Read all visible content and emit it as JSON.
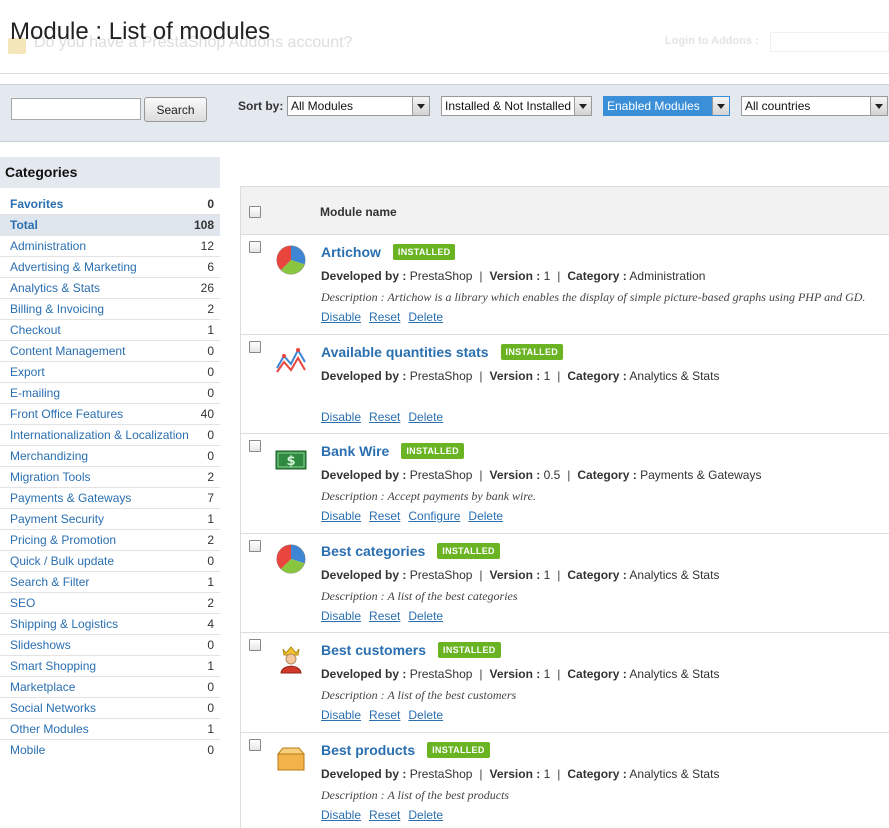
{
  "header": {
    "title": "Module : List of modules",
    "ghost_text": "Do you have a PrestaShop Addons account?",
    "ghost_login": "Login to Addons :"
  },
  "toolbar": {
    "search_value": "",
    "search_button": "Search",
    "sort_label": "Sort by:",
    "filter_all_modules": "All Modules",
    "filter_install": "Installed & Not Installed",
    "filter_enabled": "Enabled Modules",
    "filter_country": "All countries"
  },
  "sidebar": {
    "title": "Categories",
    "items": [
      {
        "label": "Favorites",
        "count": "0"
      },
      {
        "label": "Total",
        "count": "108"
      },
      {
        "label": "Administration",
        "count": "12"
      },
      {
        "label": "Advertising & Marketing",
        "count": "6"
      },
      {
        "label": "Analytics & Stats",
        "count": "26"
      },
      {
        "label": "Billing & Invoicing",
        "count": "2"
      },
      {
        "label": "Checkout",
        "count": "1"
      },
      {
        "label": "Content Management",
        "count": "0"
      },
      {
        "label": "Export",
        "count": "0"
      },
      {
        "label": "E-mailing",
        "count": "0"
      },
      {
        "label": "Front Office Features",
        "count": "40"
      },
      {
        "label": "Internationalization & Localization",
        "count": "0"
      },
      {
        "label": "Merchandizing",
        "count": "0"
      },
      {
        "label": "Migration Tools",
        "count": "2"
      },
      {
        "label": "Payments & Gateways",
        "count": "7"
      },
      {
        "label": "Payment Security",
        "count": "1"
      },
      {
        "label": "Pricing & Promotion",
        "count": "2"
      },
      {
        "label": "Quick / Bulk update",
        "count": "0"
      },
      {
        "label": "Search & Filter",
        "count": "1"
      },
      {
        "label": "SEO",
        "count": "2"
      },
      {
        "label": "Shipping & Logistics",
        "count": "4"
      },
      {
        "label": "Slideshows",
        "count": "0"
      },
      {
        "label": "Smart Shopping",
        "count": "1"
      },
      {
        "label": "Marketplace",
        "count": "0"
      },
      {
        "label": "Social Networks",
        "count": "0"
      },
      {
        "label": "Other Modules",
        "count": "1"
      },
      {
        "label": "Mobile",
        "count": "0"
      }
    ]
  },
  "table": {
    "column_title": "Module name",
    "labels": {
      "developed_by": "Developed by :",
      "version": "Version :",
      "category": "Category :"
    },
    "modules": [
      {
        "name": "Artichow",
        "badge": "INSTALLED",
        "icon": "pie-chart-icon",
        "developer": "PrestaShop",
        "version": "1",
        "category": "Administration",
        "description": "Description : Artichow is a library which enables the display of simple picture-based graphs using PHP and GD.",
        "actions": [
          "Disable",
          "Reset",
          "Delete"
        ]
      },
      {
        "name": "Available quantities stats",
        "badge": "INSTALLED",
        "icon": "line-chart-icon",
        "developer": "PrestaShop",
        "version": "1",
        "category": "Analytics & Stats",
        "description": "",
        "actions": [
          "Disable",
          "Reset",
          "Delete"
        ]
      },
      {
        "name": "Bank Wire",
        "badge": "INSTALLED",
        "icon": "banknote-icon",
        "developer": "PrestaShop",
        "version": "0.5",
        "category": "Payments & Gateways",
        "description": "Description : Accept payments by bank wire.",
        "actions": [
          "Disable",
          "Reset",
          "Configure",
          "Delete"
        ]
      },
      {
        "name": "Best categories",
        "badge": "INSTALLED",
        "icon": "pie-chart-icon",
        "developer": "PrestaShop",
        "version": "1",
        "category": "Analytics & Stats",
        "description": "Description : A list of the best categories",
        "actions": [
          "Disable",
          "Reset",
          "Delete"
        ]
      },
      {
        "name": "Best customers",
        "badge": "INSTALLED",
        "icon": "king-icon",
        "developer": "PrestaShop",
        "version": "1",
        "category": "Analytics & Stats",
        "description": "Description : A list of the best customers",
        "actions": [
          "Disable",
          "Reset",
          "Delete"
        ]
      },
      {
        "name": "Best products",
        "badge": "INSTALLED",
        "icon": "box-icon",
        "developer": "PrestaShop",
        "version": "1",
        "category": "Analytics & Stats",
        "description": "Description : A list of the best products",
        "actions": [
          "Disable",
          "Reset",
          "Delete"
        ]
      }
    ]
  },
  "colors": {
    "link": "#2a6fb0",
    "badge": "#6ab322",
    "panel": "#e4e9f0",
    "highlight": "#3b8fd9"
  }
}
